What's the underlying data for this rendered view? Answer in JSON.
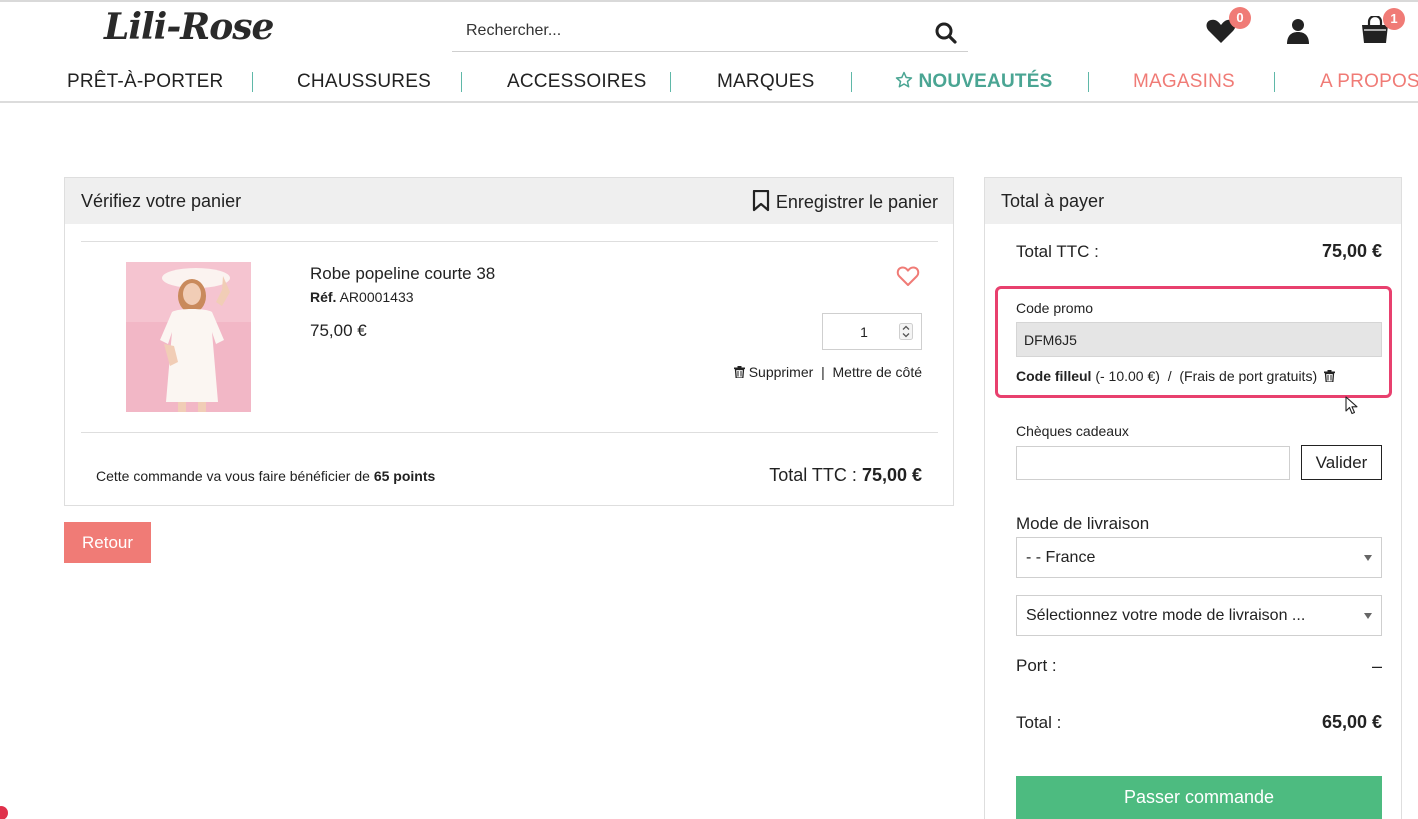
{
  "brand": {
    "logo_text": "Lili-Rose"
  },
  "search": {
    "placeholder": "Rechercher..."
  },
  "header_icons": {
    "wishlist_count": "0",
    "cart_count": "1"
  },
  "nav": {
    "items": [
      {
        "label": "PRÊT-À-PORTER"
      },
      {
        "label": "CHAUSSURES"
      },
      {
        "label": "ACCESSOIRES"
      },
      {
        "label": "MARQUES"
      },
      {
        "label": "NOUVEAUTÉS"
      },
      {
        "label": "MAGASINS"
      },
      {
        "label": "A PROPOS"
      }
    ]
  },
  "colors": {
    "accent_red": "#f07b76",
    "teal": "#4aa593",
    "highlight_pink": "#e8406e",
    "order_green": "#4dbb80"
  },
  "cart": {
    "title": "Vérifiez votre panier",
    "save_label": "Enregistrer le panier",
    "item": {
      "name": "Robe popeline courte 38",
      "ref_label": "Réf.",
      "ref_value": "AR0001433",
      "price": "75,00 €",
      "quantity": "1",
      "delete_label": "Supprimer",
      "separator": "|",
      "set_aside_label": "Mettre de côté"
    },
    "points_prefix": "Cette commande va vous faire bénéficier de",
    "points_value": "65 points",
    "total_label": "Total TTC :",
    "total_value": "75,00 €",
    "back_label": "Retour"
  },
  "summary": {
    "title": "Total à payer",
    "total_ttc_label": "Total TTC :",
    "total_ttc_value": "75,00 €",
    "promo_label": "Code promo",
    "promo_value": "DFM6J5",
    "promo_code_type": "Code filleul",
    "promo_discount": "(- 10.00 €)",
    "promo_slash": "/",
    "promo_shipping": "(Frais de port gratuits)",
    "gift_label": "Chèques cadeaux",
    "gift_placeholder": "",
    "validate_label": "Valider",
    "delivery_label": "Mode de livraison",
    "country_select": "- - France",
    "delivery_select": "Sélectionnez votre mode de livraison ...",
    "shipping_label": "Port :",
    "shipping_value": "–",
    "grand_total_label": "Total :",
    "grand_total_value": "65,00 €",
    "order_label": "Passer commande"
  }
}
